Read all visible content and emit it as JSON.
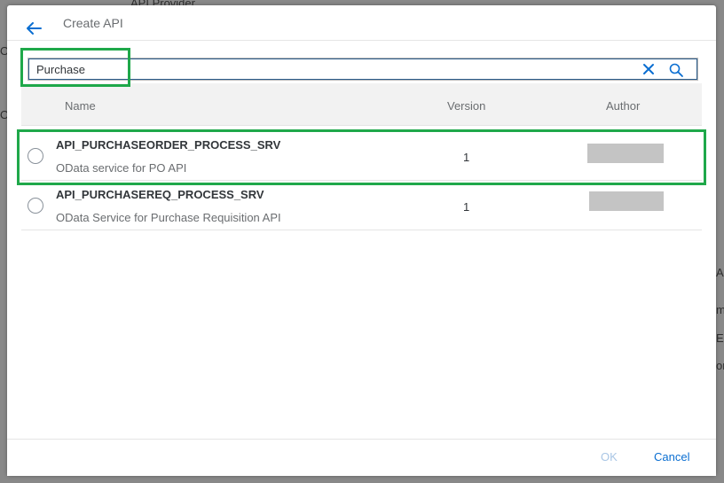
{
  "background": {
    "texts": [
      "API Provider",
      "Oa",
      "Oa",
      "AP",
      "me",
      "Es",
      "on"
    ]
  },
  "dialog": {
    "title": "Create API",
    "back_icon": "arrow-left-icon"
  },
  "search": {
    "value": "Purchase",
    "clear_icon": "close-icon",
    "search_icon": "magnifier-icon"
  },
  "table": {
    "columns": [
      "Name",
      "Version",
      "Author"
    ],
    "rows": [
      {
        "name": "API_PURCHASEORDER_PROCESS_SRV",
        "description": "OData service for PO API",
        "version": "1",
        "author": "",
        "selected": false
      },
      {
        "name": "API_PURCHASEREQ_PROCESS_SRV",
        "description": "OData Service for Purchase Requisition API",
        "version": "1",
        "author": "",
        "selected": false
      }
    ]
  },
  "footer": {
    "ok_label": "OK",
    "cancel_label": "Cancel",
    "ok_enabled": false
  },
  "colors": {
    "accent": "#0a6ed1",
    "highlight": "#1fa84a",
    "redaction": "#c4c4c4"
  }
}
